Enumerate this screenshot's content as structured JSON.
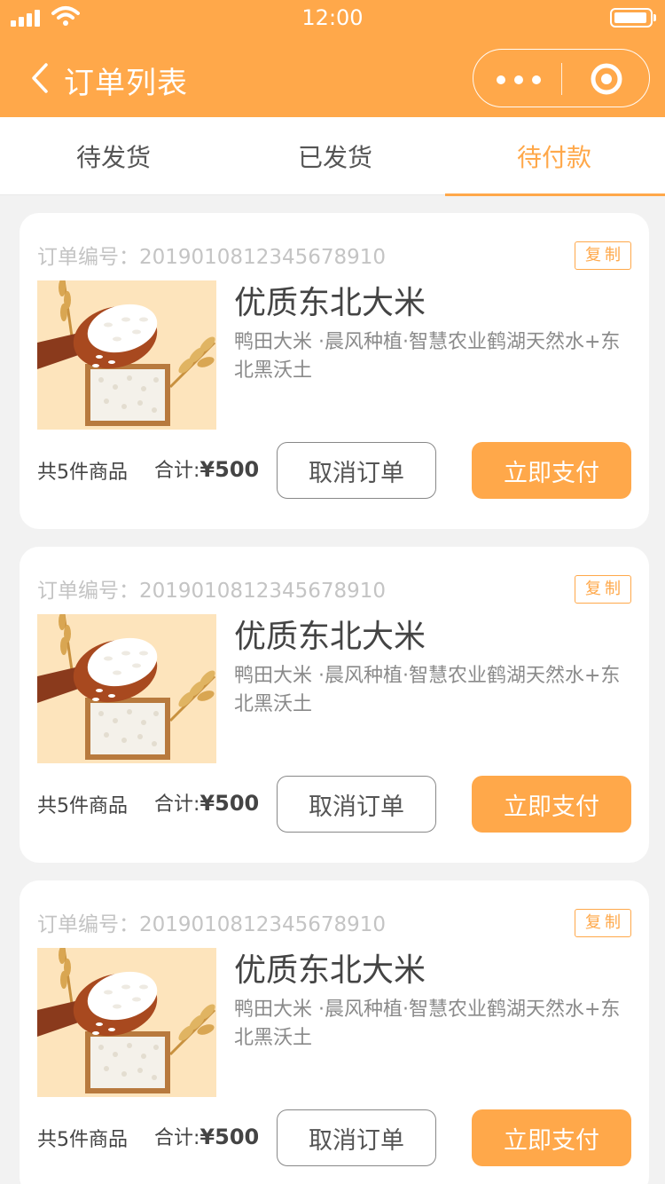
{
  "status_bar": {
    "time": "12:00"
  },
  "header": {
    "title": "订单列表",
    "back_icon": "chevron-left-icon",
    "more_icon": "more-dots-icon",
    "target_icon": "target-icon"
  },
  "tabs": [
    {
      "label": "待发货",
      "active": false
    },
    {
      "label": "已发货",
      "active": false
    },
    {
      "label": "待付款",
      "active": true
    }
  ],
  "colors": {
    "brand": "#ffa84a",
    "background": "#f2f2f2",
    "card": "#ffffff"
  },
  "orders": [
    {
      "order_no_label": "订单编号：",
      "order_no": "2019010812345678910",
      "copy_label": "复制",
      "title": "优质东北大米",
      "desc": "鸭田大米 ·晨风种植·智慧农业鹤湖天然水+东北黑沃土",
      "count_text": "共5件商品",
      "total_label": "合计:",
      "total_value": "¥500",
      "cancel_label": "取消订单",
      "pay_label": "立即支付"
    },
    {
      "order_no_label": "订单编号：",
      "order_no": "2019010812345678910",
      "copy_label": "复制",
      "title": "优质东北大米",
      "desc": "鸭田大米 ·晨风种植·智慧农业鹤湖天然水+东北黑沃土",
      "count_text": "共5件商品",
      "total_label": "合计:",
      "total_value": "¥500",
      "cancel_label": "取消订单",
      "pay_label": "立即支付"
    },
    {
      "order_no_label": "订单编号：",
      "order_no": "2019010812345678910",
      "copy_label": "复制",
      "title": "优质东北大米",
      "desc": "鸭田大米 ·晨风种植·智慧农业鹤湖天然水+东北黑沃土",
      "count_text": "共5件商品",
      "total_label": "合计:",
      "total_value": "¥500",
      "cancel_label": "取消订单",
      "pay_label": "立即支付"
    }
  ]
}
